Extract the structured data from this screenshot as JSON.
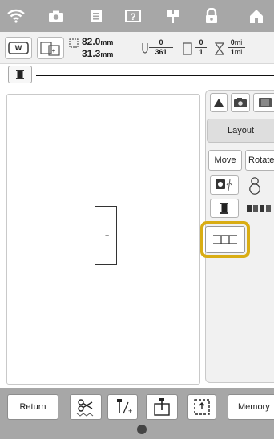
{
  "top_bar": {
    "icons": [
      "wifi-icon",
      "camera-icon",
      "document-icon",
      "help-icon",
      "needle-icon",
      "lock-icon",
      "home-icon"
    ]
  },
  "info_bar": {
    "width_value": "82.0",
    "height_value": "31.3",
    "unit": "mm",
    "stitch_current": "0",
    "stitch_total": "361",
    "color_current": "0",
    "color_total": "1",
    "time_current": "0",
    "time_unit": "mi",
    "time_total": "1",
    "time_total_unit": "mi"
  },
  "panel": {
    "layout_label": "Layout",
    "move_label": "Move",
    "rotate_label": "Rotate"
  },
  "bottom_bar": {
    "return_label": "Return",
    "memory_label": "Memory"
  },
  "colors": {
    "bar_gray": "#a7a7a7",
    "highlight_gold": "#d9ad14"
  }
}
